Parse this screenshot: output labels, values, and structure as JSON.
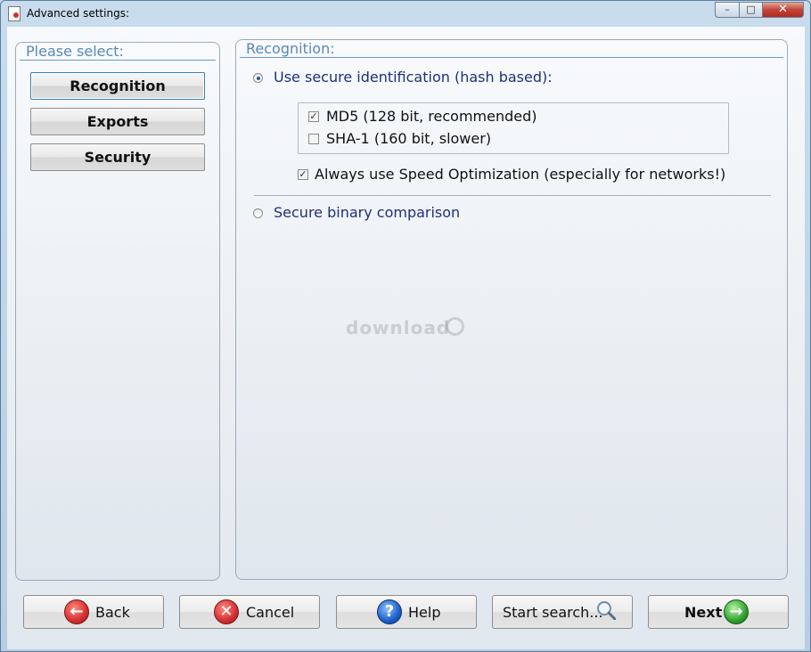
{
  "window": {
    "title": "Advanced settings:",
    "minimize_glyph": "–",
    "maximize_glyph": "□",
    "close_glyph": "✕"
  },
  "left_panel": {
    "title": "Please select:",
    "items": [
      {
        "label": "Recognition",
        "active": true
      },
      {
        "label": "Exports",
        "active": false
      },
      {
        "label": "Security",
        "active": false
      }
    ]
  },
  "right_panel": {
    "title": "Recognition:",
    "option_hash": {
      "label": "Use secure identification (hash based):",
      "selected": true
    },
    "md5": {
      "label": "MD5 (128 bit, recommended)",
      "checked": true
    },
    "sha1": {
      "label": "SHA-1 (160 bit, slower)",
      "checked": false
    },
    "speed": {
      "label": "Always use Speed Optimization (especially for networks!)",
      "checked": true
    },
    "option_binary": {
      "label": "Secure binary comparison",
      "selected": false
    }
  },
  "watermark": {
    "text": "download"
  },
  "buttons": {
    "back": {
      "label": "Back",
      "icon": "back-arrow-icon"
    },
    "cancel": {
      "label": "Cancel",
      "icon": "cancel-x-icon"
    },
    "help": {
      "label": "Help",
      "icon": "help-question-icon"
    },
    "start_search": {
      "label": "Start search...",
      "icon": "magnifier-icon"
    },
    "next": {
      "label": "Next",
      "icon": "next-arrow-icon"
    }
  },
  "colors": {
    "panel_title": "#5a88b8",
    "option_text": "#1f2f7a",
    "close_button": "#c1443a"
  }
}
